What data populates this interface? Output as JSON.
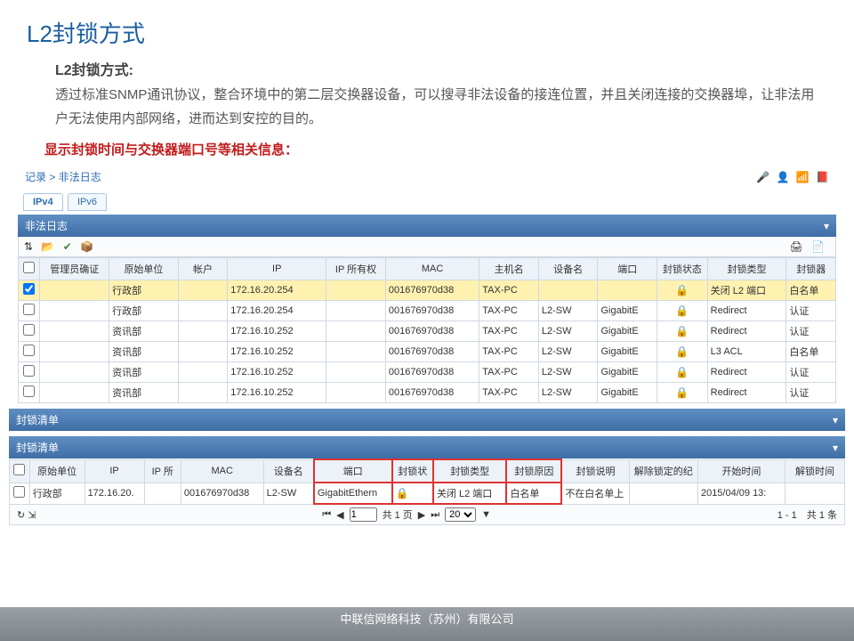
{
  "title": "L2封锁方式",
  "subtitle": "L2封锁方式:",
  "desc": " 透过标准SNMP通讯协议，整合环境中的第二层交换器设备，可以搜寻非法设备的接连位置，并且关闭连接的交换器埠，让非法用户无法使用内部网络，进而达到安控的目的。",
  "redline": "显示封锁时间与交换器端口号等相关信息：",
  "crumb": {
    "p1": "记录",
    "sep": ">",
    "p2": "非法日志"
  },
  "tabs": {
    "ipv4": "IPv4",
    "ipv6": "IPv6"
  },
  "bar1": "非法日志",
  "cols1": [
    "",
    "管理员确证",
    "原始单位",
    "帐户",
    "IP",
    "IP 所有权",
    "MAC",
    "主机名",
    "设备名",
    "端口",
    "封锁状态",
    "封锁类型",
    "封锁器"
  ],
  "rows1": [
    {
      "sel": true,
      "unit": "行政部",
      "ip": "172.16.20.254",
      "mac": "001676970d38",
      "host": "TAX-PC",
      "dev": "",
      "port": "",
      "state": "lock",
      "type": "关闭 L2 端口",
      "blocker": "白名单"
    },
    {
      "sel": false,
      "unit": "行政部",
      "ip": "172.16.20.254",
      "mac": "001676970d38",
      "host": "TAX-PC",
      "dev": "L2-SW",
      "port": "GigabitE",
      "state": "lock",
      "type": "Redirect",
      "blocker": "认证"
    },
    {
      "sel": false,
      "unit": "资讯部",
      "ip": "172.16.10.252",
      "mac": "001676970d38",
      "host": "TAX-PC",
      "dev": "L2-SW",
      "port": "GigabitE",
      "state": "lock",
      "type": "Redirect",
      "blocker": "认证"
    },
    {
      "sel": false,
      "unit": "资讯部",
      "ip": "172.16.10.252",
      "mac": "001676970d38",
      "host": "TAX-PC",
      "dev": "L2-SW",
      "port": "GigabitE",
      "state": "lock",
      "type": "L3 ACL",
      "blocker": "白名单"
    },
    {
      "sel": false,
      "unit": "资讯部",
      "ip": "172.16.10.252",
      "mac": "001676970d38",
      "host": "TAX-PC",
      "dev": "L2-SW",
      "port": "GigabitE",
      "state": "lock",
      "type": "Redirect",
      "blocker": "认证"
    },
    {
      "sel": false,
      "unit": "资讯部",
      "ip": "172.16.10.252",
      "mac": "001676970d38",
      "host": "TAX-PC",
      "dev": "L2-SW",
      "port": "GigabitE",
      "state": "green",
      "type": "Redirect",
      "blocker": "认证"
    }
  ],
  "bar2a": "封锁清单",
  "bar2b": "封锁清单",
  "cols2": [
    "",
    "原始单位",
    "IP",
    "IP 所",
    "MAC",
    "设备名",
    "端口",
    "封锁状",
    "封锁类型",
    "封锁原因",
    "封锁说明",
    "解除锁定的纪",
    "开始时间",
    "解锁时间"
  ],
  "row2": {
    "unit": "行政部",
    "ip": "172.16.20.",
    "mac": "001676970d38",
    "dev": "L2-SW",
    "port": "GigabitEthern",
    "type": "关闭 L2 端口",
    "reason": "白名单",
    "note": "不在白名单上",
    "start": "2015/04/09 13:"
  },
  "pager": {
    "page": "1",
    "pages_label": "共 1 页",
    "per": "20",
    "summary": "1 - 1　共 1 条"
  },
  "footer": "中联信网络科技（苏州）有限公司"
}
